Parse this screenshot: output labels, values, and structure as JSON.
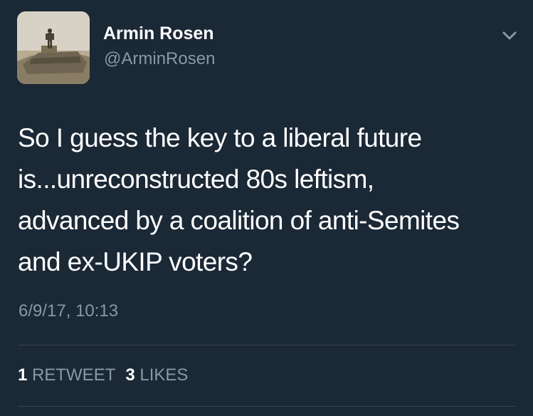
{
  "author": {
    "display_name": "Armin Rosen",
    "handle": "@ArminRosen",
    "avatar_icon": "profile-photo-on-tank"
  },
  "menu": {
    "icon": "chevron-down-icon"
  },
  "tweet": {
    "lines": [
      "So I guess the key to a liberal future",
      "is...unreconstructed 80s leftism,",
      "advanced by a coalition of anti-Semites",
      "and ex-UKIP voters?"
    ],
    "timestamp": "6/9/17, 10:13"
  },
  "stats": {
    "retweets": {
      "count": "1",
      "label": "RETWEET"
    },
    "likes": {
      "count": "3",
      "label": "LIKES"
    }
  },
  "colors": {
    "background": "#1b2836",
    "text_primary": "#ffffff",
    "text_secondary": "#8899a6",
    "divider": "#38444d"
  }
}
